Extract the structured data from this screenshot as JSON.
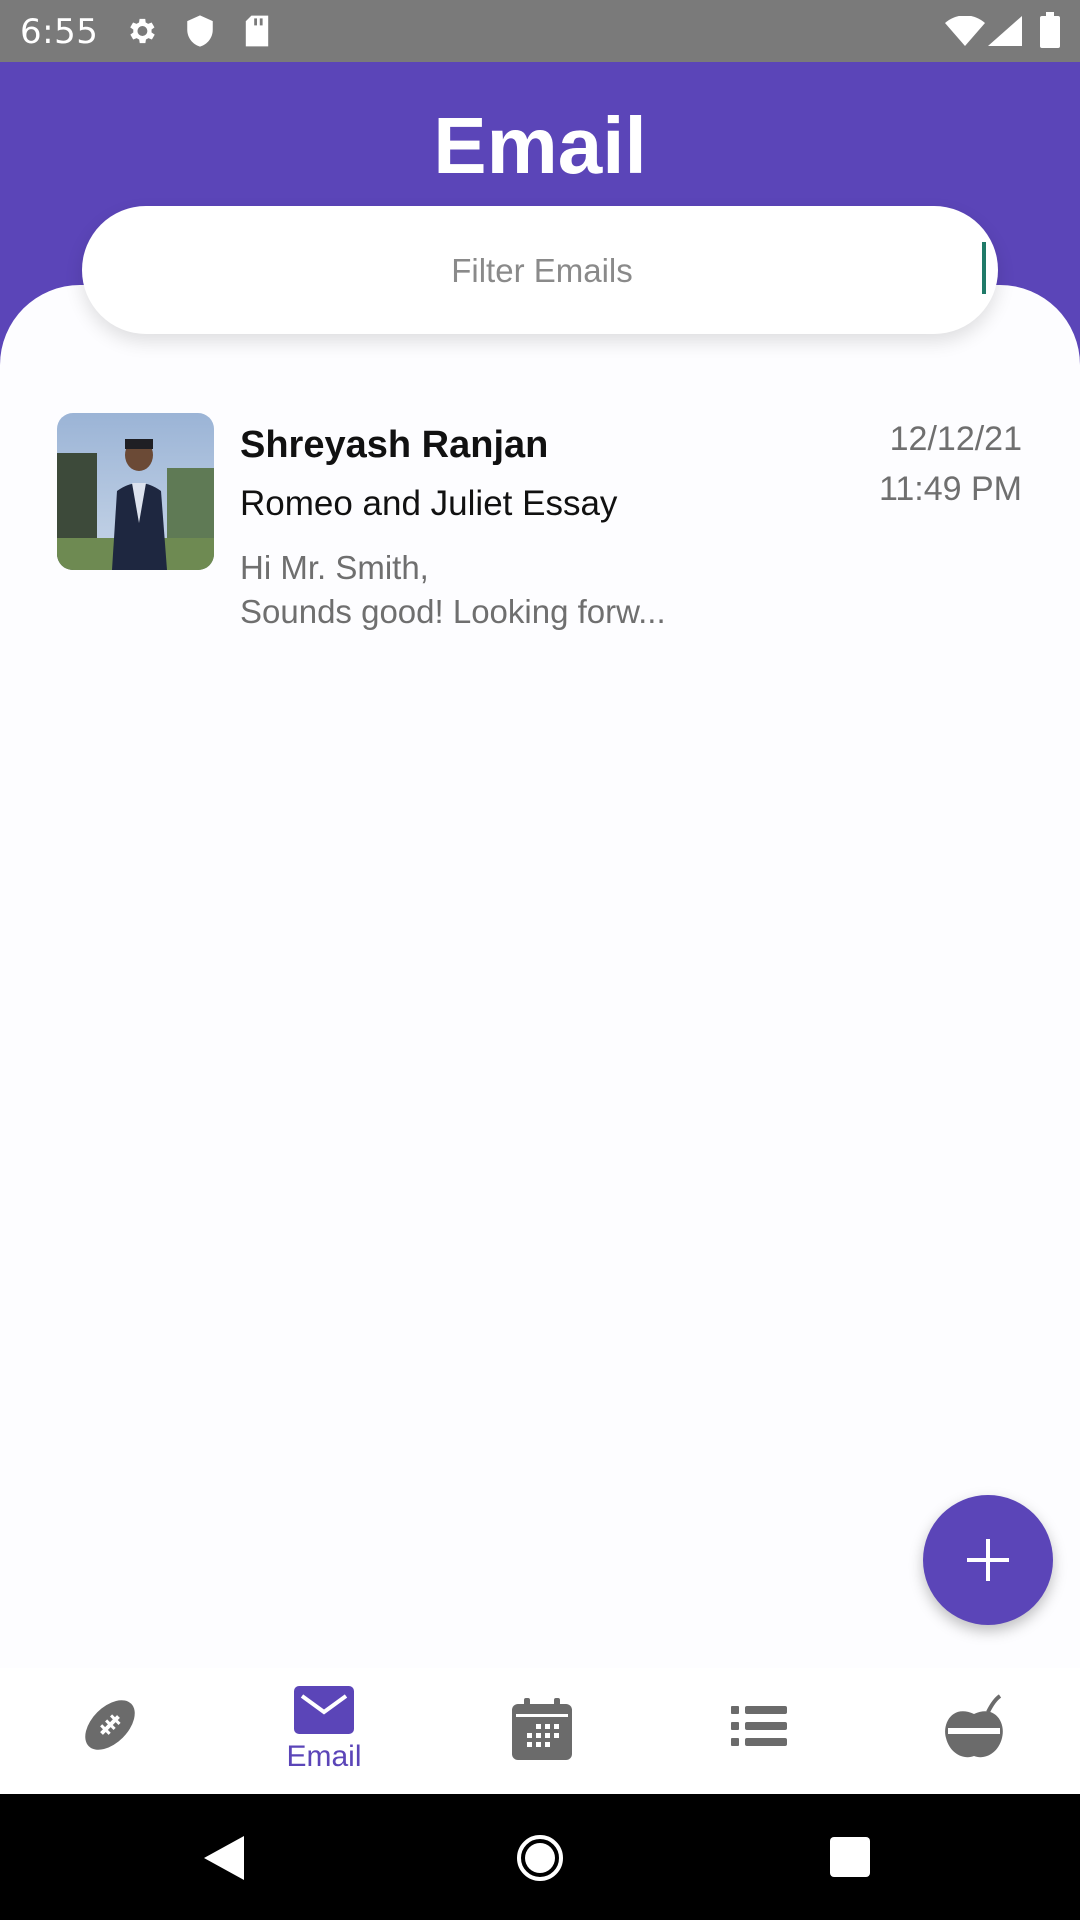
{
  "status_bar": {
    "time": "6:55",
    "icons": [
      "gear-icon",
      "shield-icon",
      "sd-card-icon",
      "wifi-icon",
      "signal-icon",
      "battery-icon"
    ]
  },
  "header": {
    "title": "Email"
  },
  "search": {
    "placeholder": "Filter Emails",
    "value": ""
  },
  "emails": [
    {
      "sender": "Shreyash Ranjan",
      "subject": "Romeo and Juliet Essay",
      "preview_line1": "Hi Mr. Smith,",
      "preview_line2": "Sounds good! Looking forw...",
      "date": "12/12/21",
      "time": "11:49 PM"
    }
  ],
  "fab": {
    "icon": "plus-icon"
  },
  "bottom_nav": {
    "items": [
      {
        "icon": "football-icon",
        "label": ""
      },
      {
        "icon": "mail-icon",
        "label": "Email",
        "active": true
      },
      {
        "icon": "calendar-icon",
        "label": ""
      },
      {
        "icon": "list-icon",
        "label": ""
      },
      {
        "icon": "apple-icon",
        "label": ""
      }
    ]
  },
  "colors": {
    "accent": "#5b45b8",
    "status_bar": "#7a7a7a",
    "sheet": "#fdfdff",
    "muted_text": "#6f6f6f"
  }
}
